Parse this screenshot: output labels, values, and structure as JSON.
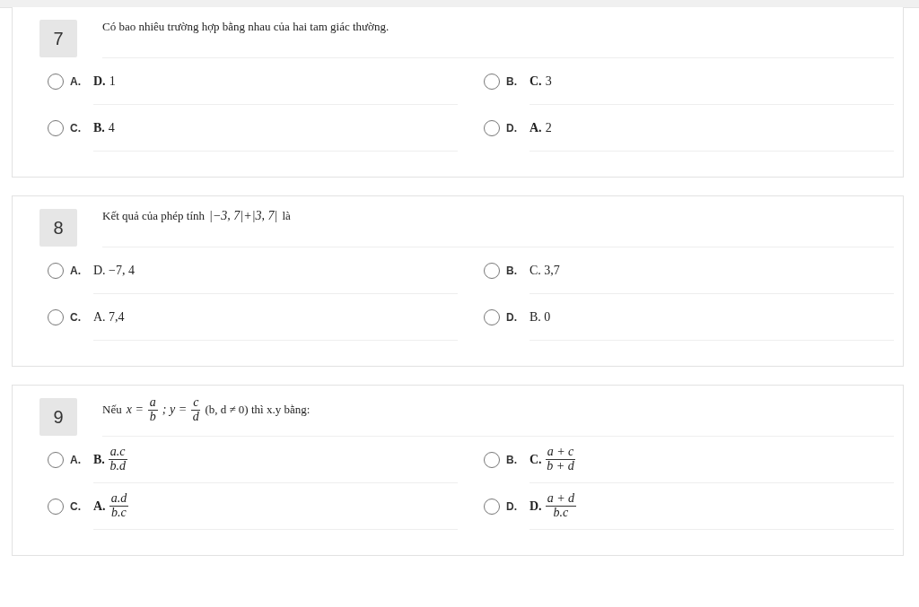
{
  "questions": [
    {
      "number": "7",
      "text": [
        {
          "kind": "text",
          "value": "Có bao nhiêu trường hợp bằng nhau của hai tam giác thường."
        }
      ],
      "options": [
        {
          "letter": "A.",
          "selected": false,
          "content": [
            {
              "kind": "bold",
              "value": "D."
            },
            {
              "kind": "text",
              "value": "1"
            }
          ]
        },
        {
          "letter": "B.",
          "selected": false,
          "content": [
            {
              "kind": "bold",
              "value": "C."
            },
            {
              "kind": "text",
              "value": "3"
            }
          ]
        },
        {
          "letter": "C.",
          "selected": false,
          "content": [
            {
              "kind": "bold",
              "value": "B."
            },
            {
              "kind": "text",
              "value": "4"
            }
          ]
        },
        {
          "letter": "D.",
          "selected": false,
          "content": [
            {
              "kind": "bold",
              "value": "A."
            },
            {
              "kind": "text",
              "value": "2"
            }
          ]
        }
      ]
    },
    {
      "number": "8",
      "text": [
        {
          "kind": "text",
          "value": "Kết quả của phép tính"
        },
        {
          "kind": "math",
          "value": "|−3, 7|+|3, 7|"
        },
        {
          "kind": "text",
          "value": "là"
        }
      ],
      "options": [
        {
          "letter": "A.",
          "selected": false,
          "content": [
            {
              "kind": "text",
              "value": "D. −7, 4"
            }
          ]
        },
        {
          "letter": "B.",
          "selected": false,
          "content": [
            {
              "kind": "text",
              "value": "C. 3,7"
            }
          ]
        },
        {
          "letter": "C.",
          "selected": false,
          "content": [
            {
              "kind": "text",
              "value": "A. 7,4"
            }
          ]
        },
        {
          "letter": "D.",
          "selected": false,
          "content": [
            {
              "kind": "text",
              "value": "B. 0"
            }
          ]
        }
      ]
    },
    {
      "number": "9",
      "text": [
        {
          "kind": "text",
          "value": "Nếu"
        },
        {
          "kind": "math",
          "value": "x ="
        },
        {
          "kind": "frac",
          "num": "a",
          "den": "b"
        },
        {
          "kind": "math",
          "value": "; y ="
        },
        {
          "kind": "frac",
          "num": "c",
          "den": "d"
        },
        {
          "kind": "text",
          "value": "(b, d ≠ 0) thì x.y bằng:"
        }
      ],
      "options": [
        {
          "letter": "A.",
          "selected": false,
          "content": [
            {
              "kind": "bold",
              "value": "B."
            },
            {
              "kind": "frac",
              "num": "a.c",
              "den": "b.d"
            }
          ]
        },
        {
          "letter": "B.",
          "selected": false,
          "content": [
            {
              "kind": "bold",
              "value": "C."
            },
            {
              "kind": "frac",
              "num": "a + c",
              "den": "b + d"
            }
          ]
        },
        {
          "letter": "C.",
          "selected": false,
          "content": [
            {
              "kind": "bold",
              "value": "A."
            },
            {
              "kind": "frac",
              "num": "a.d",
              "den": "b.c"
            }
          ]
        },
        {
          "letter": "D.",
          "selected": false,
          "content": [
            {
              "kind": "bold",
              "value": "D."
            },
            {
              "kind": "frac",
              "num": "a + d",
              "den": "b.c"
            }
          ]
        }
      ]
    }
  ]
}
